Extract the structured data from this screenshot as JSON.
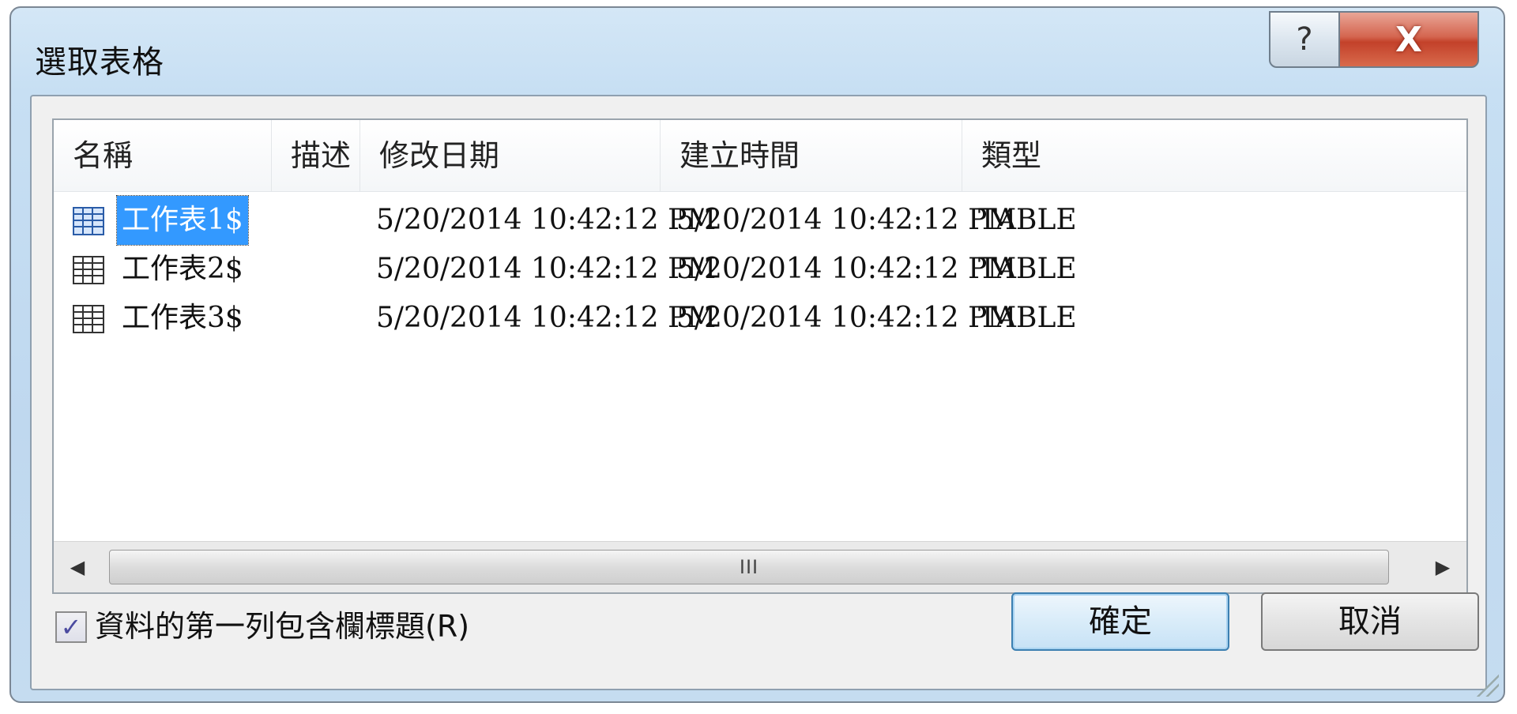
{
  "window": {
    "title": "選取表格",
    "help_label": "?",
    "close_label": "X"
  },
  "table": {
    "columns": [
      "名稱",
      "描述",
      "修改日期",
      "建立時間",
      "類型"
    ],
    "rows": [
      {
        "name": "工作表1$",
        "description": "",
        "modified": "5/20/2014 10:42:12 PM",
        "created": "5/20/2014 10:42:12 PM",
        "type": "TABLE",
        "selected": true,
        "icon": "table-icon"
      },
      {
        "name": "工作表2$",
        "description": "",
        "modified": "5/20/2014 10:42:12 PM",
        "created": "5/20/2014 10:42:12 PM",
        "type": "TABLE",
        "selected": false,
        "icon": "table-icon"
      },
      {
        "name": "工作表3$",
        "description": "",
        "modified": "5/20/2014 10:42:12 PM",
        "created": "5/20/2014 10:42:12 PM",
        "type": "TABLE",
        "selected": false,
        "icon": "table-icon"
      }
    ]
  },
  "scrollbar": {
    "left_arrow": "◀",
    "right_arrow": "▶",
    "thumb_grip": "III"
  },
  "options": {
    "header_row_checkbox_label": "資料的第一列包含欄標題(R)",
    "header_row_checked": true,
    "check_mark": "✓"
  },
  "buttons": {
    "ok_label": "確定",
    "cancel_label": "取消"
  }
}
